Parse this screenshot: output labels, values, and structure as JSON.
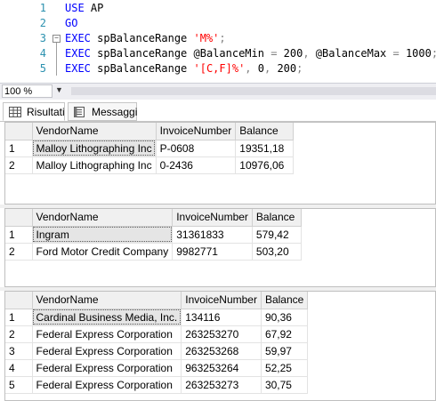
{
  "editor": {
    "lines": [
      {
        "num": "1",
        "parts": [
          {
            "t": "USE",
            "c": "kw"
          },
          {
            "t": " AP",
            "c": "plain"
          }
        ]
      },
      {
        "num": "2",
        "parts": [
          {
            "t": "GO",
            "c": "kw"
          }
        ]
      },
      {
        "num": "3",
        "parts": [
          {
            "t": "EXEC",
            "c": "kw"
          },
          {
            "t": " spBalanceRange ",
            "c": "plain"
          },
          {
            "t": "'M%'",
            "c": "str"
          },
          {
            "t": ";",
            "c": "op"
          }
        ]
      },
      {
        "num": "4",
        "parts": [
          {
            "t": "EXEC",
            "c": "kw"
          },
          {
            "t": " spBalanceRange @BalanceMin ",
            "c": "plain"
          },
          {
            "t": "=",
            "c": "op"
          },
          {
            "t": " 200",
            "c": "plain"
          },
          {
            "t": ",",
            "c": "op"
          },
          {
            "t": " @BalanceMax ",
            "c": "plain"
          },
          {
            "t": "=",
            "c": "op"
          },
          {
            "t": " 1000",
            "c": "plain"
          },
          {
            "t": ";",
            "c": "op"
          }
        ]
      },
      {
        "num": "5",
        "parts": [
          {
            "t": "EXEC",
            "c": "kw"
          },
          {
            "t": " spBalanceRange ",
            "c": "plain"
          },
          {
            "t": "'[C,F]%'",
            "c": "str"
          },
          {
            "t": ",",
            "c": "op"
          },
          {
            "t": " 0",
            "c": "plain"
          },
          {
            "t": ",",
            "c": "op"
          },
          {
            "t": " 200",
            "c": "plain"
          },
          {
            "t": ";",
            "c": "op"
          }
        ]
      }
    ]
  },
  "zoom": {
    "value": "100 %"
  },
  "tabs": {
    "results": "Risultati",
    "messages": "Messaggi"
  },
  "results": [
    {
      "columns": [
        "VendorName",
        "InvoiceNumber",
        "Balance"
      ],
      "rows": [
        [
          "1",
          "Malloy Lithographing Inc",
          "P-0608",
          "19351,18"
        ],
        [
          "2",
          "Malloy Lithographing Inc",
          "0-2436",
          "10976,06"
        ]
      ]
    },
    {
      "columns": [
        "VendorName",
        "InvoiceNumber",
        "Balance"
      ],
      "rows": [
        [
          "1",
          "Ingram",
          "31361833",
          "579,42"
        ],
        [
          "2",
          "Ford Motor Credit Company",
          "9982771",
          "503,20"
        ]
      ]
    },
    {
      "columns": [
        "VendorName",
        "InvoiceNumber",
        "Balance"
      ],
      "rows": [
        [
          "1",
          "Cardinal Business Media, Inc.",
          "134116",
          "90,36"
        ],
        [
          "2",
          "Federal Express Corporation",
          "263253270",
          "67,92"
        ],
        [
          "3",
          "Federal Express Corporation",
          "263253268",
          "59,97"
        ],
        [
          "4",
          "Federal Express Corporation",
          "963253264",
          "52,25"
        ],
        [
          "5",
          "Federal Express Corporation",
          "263253273",
          "30,75"
        ]
      ]
    }
  ],
  "colors": {
    "keyword": "#0000ff",
    "string": "#ff0000",
    "line_number": "#2b91af",
    "change_marker": "#e8d36a"
  }
}
